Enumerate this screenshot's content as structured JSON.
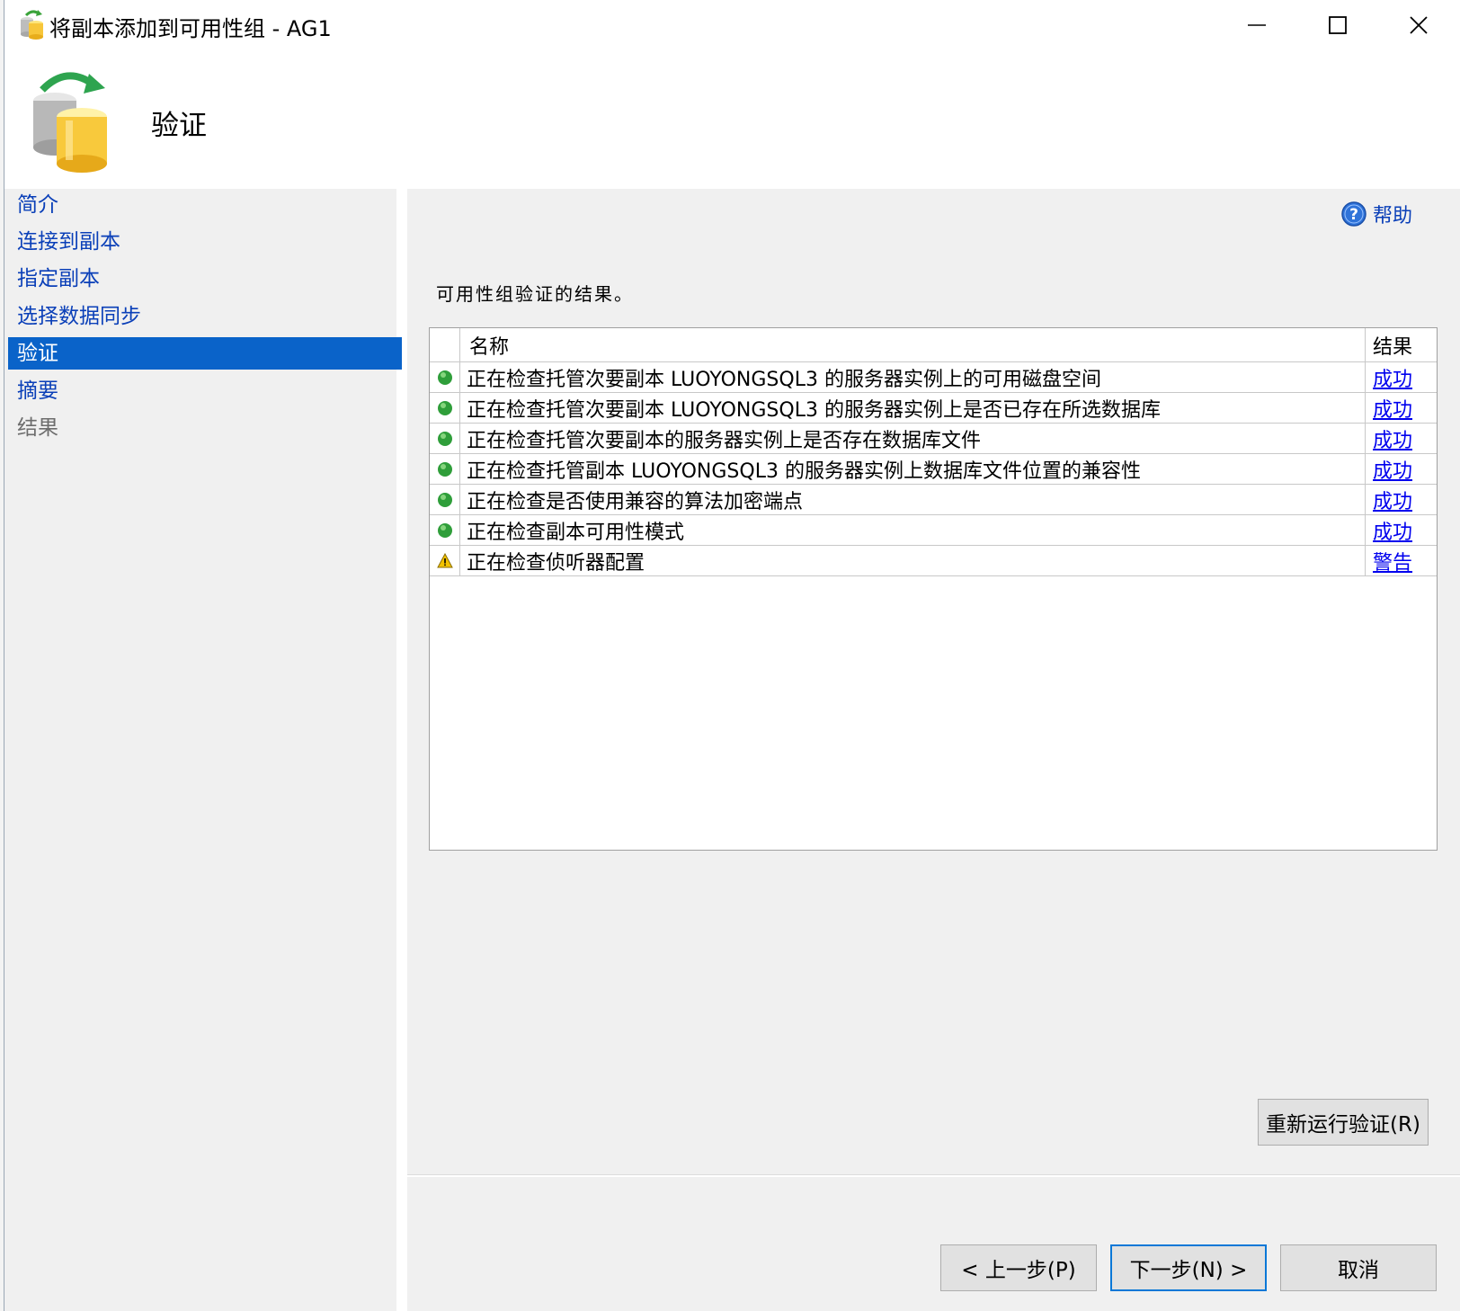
{
  "window": {
    "title": "将副本添加到可用性组 - AG1"
  },
  "header": {
    "title": "验证"
  },
  "sidebar": {
    "items": [
      {
        "label": "简介",
        "state": "link"
      },
      {
        "label": "连接到副本",
        "state": "link"
      },
      {
        "label": "指定副本",
        "state": "link"
      },
      {
        "label": "选择数据同步",
        "state": "link"
      },
      {
        "label": "验证",
        "state": "selected"
      },
      {
        "label": "摘要",
        "state": "link"
      },
      {
        "label": "结果",
        "state": "disabled"
      }
    ]
  },
  "content": {
    "help_label": "帮助",
    "caption": "可用性组验证的结果。",
    "table": {
      "columns": [
        "名称",
        "结果"
      ],
      "rows": [
        {
          "status": "success",
          "name": "正在检查托管次要副本 LUOYONGSQL3 的服务器实例上的可用磁盘空间",
          "result": "成功"
        },
        {
          "status": "success",
          "name": "正在检查托管次要副本 LUOYONGSQL3 的服务器实例上是否已存在所选数据库",
          "result": "成功"
        },
        {
          "status": "success",
          "name": "正在检查托管次要副本的服务器实例上是否存在数据库文件",
          "result": "成功"
        },
        {
          "status": "success",
          "name": "正在检查托管副本 LUOYONGSQL3 的服务器实例上数据库文件位置的兼容性",
          "result": "成功"
        },
        {
          "status": "success",
          "name": "正在检查是否使用兼容的算法加密端点",
          "result": "成功"
        },
        {
          "status": "success",
          "name": "正在检查副本可用性模式",
          "result": "成功"
        },
        {
          "status": "warning",
          "name": "正在检查侦听器配置",
          "result": "警告"
        }
      ]
    },
    "rerun_button": "重新运行验证(R)"
  },
  "footer": {
    "prev_button": "< 上一步(P)",
    "next_button": "下一步(N) >",
    "cancel_button": "取消"
  },
  "colors": {
    "accent": "#0a63c9",
    "link": "#0a3fb8",
    "success": "#2f9e3a",
    "warning": "#f2c200"
  }
}
